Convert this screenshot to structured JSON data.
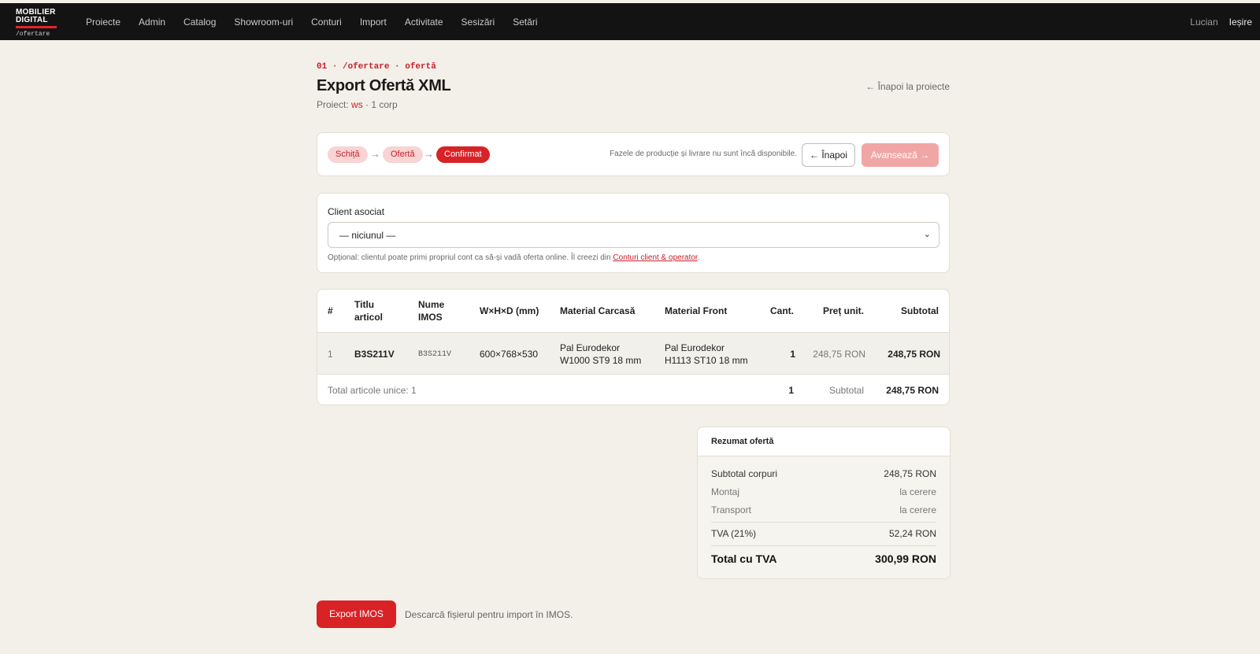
{
  "header": {
    "logo": {
      "line1": "MOBILIER",
      "line2": "DIGITAL",
      "sub": "/ofertare"
    },
    "nav": [
      "Proiecte",
      "Admin",
      "Catalog",
      "Showroom-uri",
      "Conturi",
      "Import",
      "Activitate",
      "Sesizări",
      "Setări"
    ],
    "user": "Lucian",
    "logout": "Ieșire"
  },
  "page": {
    "breadcrumb": "01 · /ofertare · ofertă",
    "title": "Export Ofertă XML",
    "project_label": "Proiect:",
    "project_name": "ws",
    "project_suffix": "· 1 corp",
    "back_link": "← Înapoi la proiecte"
  },
  "status": {
    "steps": [
      "Schiță",
      "Ofertă",
      "Confirmat"
    ],
    "arrow": "→",
    "active_step": "Confirmat",
    "note": "Fazele de producție și livrare nu sunt încă disponibile.",
    "back_button": "← Înapoi",
    "advance_button": "Avansează →"
  },
  "client": {
    "label": "Client asociat",
    "selected": "— niciunul —",
    "chevron": "⌄",
    "note_prefix": "Opțional: clientul poate primi propriul cont ca să-și vadă oferta online. Îl creezi din ",
    "note_link": "Conturi client & operator",
    "note_suffix": "."
  },
  "table": {
    "headers": {
      "num": "#",
      "title_l1": "Titlu",
      "title_l2": "articol",
      "imos_l1": "Nume",
      "imos_l2": "IMOS",
      "dims": "W×H×D (mm)",
      "carcass": "Material Carcasă",
      "front": "Material Front",
      "qty": "Cant.",
      "unit_price": "Preț unit.",
      "subtotal": "Subtotal"
    },
    "rows": [
      {
        "num": "1",
        "title": "B3S211V",
        "imos": "B3S211V",
        "dims": "600×768×530",
        "carcass_l1": "Pal Eurodekor",
        "carcass_l2": "W1000 ST9 18 mm",
        "front_l1": "Pal Eurodekor",
        "front_l2": "H1113 ST10 18 mm",
        "qty": "1",
        "unit_price": "248,75 RON",
        "subtotal": "248,75 RON"
      }
    ],
    "footer": {
      "count_text": "Total articole unice: 1",
      "qty": "1",
      "label": "Subtotal",
      "value": "248,75 RON"
    }
  },
  "summary": {
    "title": "Rezumat ofertă",
    "subtotal_label": "Subtotal corpuri",
    "subtotal_value": "248,75 RON",
    "montaj_label": "Montaj",
    "montaj_value": "la cerere",
    "transport_label": "Transport",
    "transport_value": "la cerere",
    "vat_label": "TVA (21%)",
    "vat_value": "52,24 RON",
    "total_label": "Total cu TVA",
    "total_value": "300,99 RON"
  },
  "export": {
    "button": "Export IMOS",
    "note": "Descarcă fișierul pentru import în IMOS."
  }
}
